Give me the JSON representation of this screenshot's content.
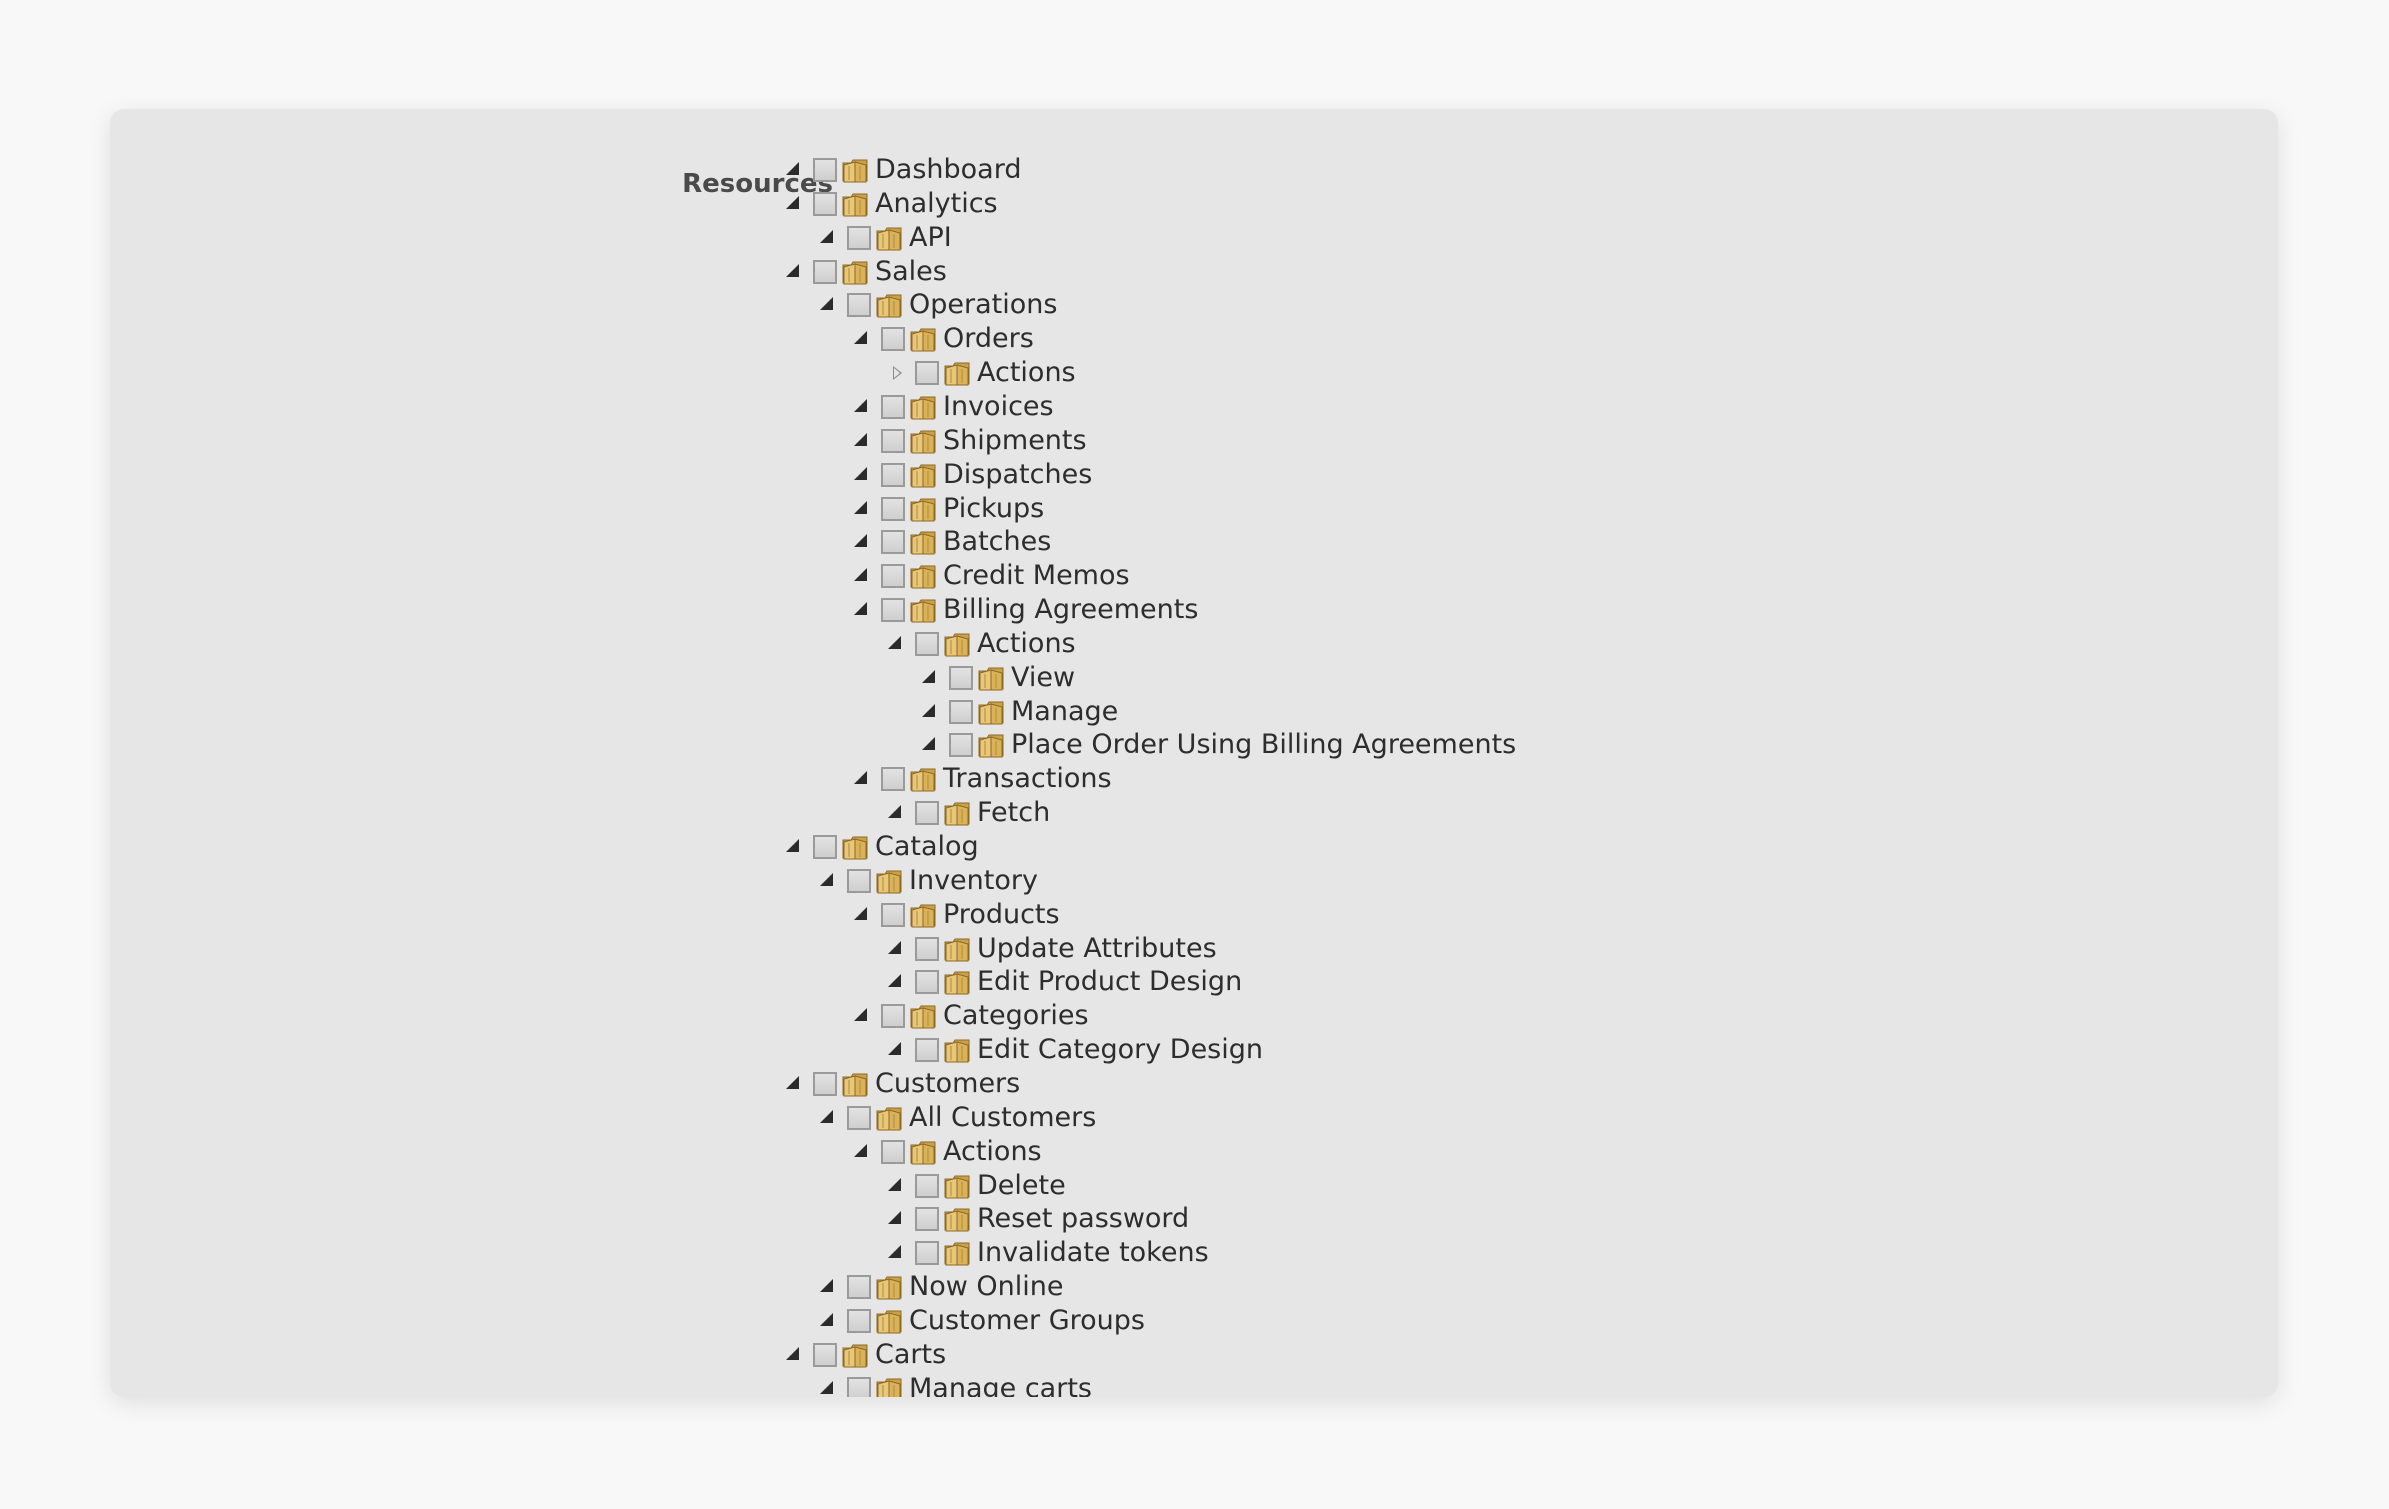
{
  "section_label": "Resources",
  "tree": [
    {
      "label": "Dashboard",
      "depth": 0,
      "state": "expanded"
    },
    {
      "label": "Analytics",
      "depth": 0,
      "state": "expanded"
    },
    {
      "label": "API",
      "depth": 1,
      "state": "expanded"
    },
    {
      "label": "Sales",
      "depth": 0,
      "state": "expanded"
    },
    {
      "label": "Operations",
      "depth": 1,
      "state": "expanded"
    },
    {
      "label": "Orders",
      "depth": 2,
      "state": "expanded"
    },
    {
      "label": "Actions",
      "depth": 3,
      "state": "collapsed"
    },
    {
      "label": "Invoices",
      "depth": 2,
      "state": "expanded"
    },
    {
      "label": "Shipments",
      "depth": 2,
      "state": "expanded"
    },
    {
      "label": "Dispatches",
      "depth": 2,
      "state": "expanded"
    },
    {
      "label": "Pickups",
      "depth": 2,
      "state": "expanded"
    },
    {
      "label": "Batches",
      "depth": 2,
      "state": "expanded"
    },
    {
      "label": "Credit Memos",
      "depth": 2,
      "state": "expanded"
    },
    {
      "label": "Billing Agreements",
      "depth": 2,
      "state": "expanded"
    },
    {
      "label": "Actions",
      "depth": 3,
      "state": "expanded"
    },
    {
      "label": "View",
      "depth": 4,
      "state": "expanded"
    },
    {
      "label": "Manage",
      "depth": 4,
      "state": "expanded"
    },
    {
      "label": "Place Order Using Billing Agreements",
      "depth": 4,
      "state": "expanded"
    },
    {
      "label": "Transactions",
      "depth": 2,
      "state": "expanded"
    },
    {
      "label": "Fetch",
      "depth": 3,
      "state": "expanded"
    },
    {
      "label": "Catalog",
      "depth": 0,
      "state": "expanded"
    },
    {
      "label": "Inventory",
      "depth": 1,
      "state": "expanded"
    },
    {
      "label": "Products",
      "depth": 2,
      "state": "expanded"
    },
    {
      "label": "Update Attributes",
      "depth": 3,
      "state": "expanded"
    },
    {
      "label": "Edit Product Design",
      "depth": 3,
      "state": "expanded"
    },
    {
      "label": "Categories",
      "depth": 2,
      "state": "expanded"
    },
    {
      "label": "Edit Category Design",
      "depth": 3,
      "state": "expanded"
    },
    {
      "label": "Customers",
      "depth": 0,
      "state": "expanded"
    },
    {
      "label": "All Customers",
      "depth": 1,
      "state": "expanded"
    },
    {
      "label": "Actions",
      "depth": 2,
      "state": "expanded"
    },
    {
      "label": "Delete",
      "depth": 3,
      "state": "expanded"
    },
    {
      "label": "Reset password",
      "depth": 3,
      "state": "expanded"
    },
    {
      "label": "Invalidate tokens",
      "depth": 3,
      "state": "expanded"
    },
    {
      "label": "Now Online",
      "depth": 1,
      "state": "expanded"
    },
    {
      "label": "Customer Groups",
      "depth": 1,
      "state": "expanded"
    },
    {
      "label": "Carts",
      "depth": 0,
      "state": "expanded"
    },
    {
      "label": "Manage carts",
      "depth": 1,
      "state": "expanded"
    }
  ],
  "icons": {
    "toggle_expanded": "triangle-expanded-icon",
    "toggle_collapsed": "triangle-collapsed-icon",
    "checkbox": "checkbox-unchecked",
    "folder": "folder-icon"
  },
  "colors": {
    "panel_background": "#e6e6e6",
    "page_background": "#f8f8f8",
    "text": "#2d2d2d",
    "folder": "#d9b25a"
  }
}
